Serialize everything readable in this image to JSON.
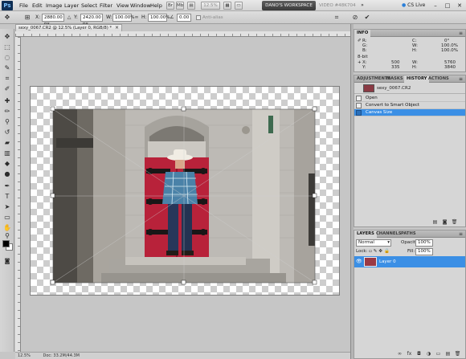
{
  "app": {
    "logo": "Ps"
  },
  "menubar": {
    "items": [
      "File",
      "Edit",
      "Image",
      "Layer",
      "Select",
      "Filter",
      "View",
      "Window",
      "Help"
    ],
    "zoom": "12.5%",
    "workspace": "DANO'S WORKSPACE",
    "video_tab": "VIDEO #48K704",
    "cs_live": "CS Live",
    "controls": [
      "–",
      "□",
      "✕"
    ]
  },
  "options": {
    "x_label": "X:",
    "x_value": "2880.00 px",
    "y_label": "Y:",
    "y_value": "2420.00 px",
    "w_label": "W:",
    "w_value": "100.00%",
    "h_label": "H:",
    "h_value": "100.00%",
    "angle_value": "0.00",
    "antialias": "Anti-alias",
    "cancel_icon": "cancel-transform-icon",
    "commit_icon": "commit-transform-icon"
  },
  "document": {
    "tab_title": "sexy_0067.CR2 @ 12.5% (Layer 0, RGB/8) *",
    "status_zoom": "12.5%",
    "status_info": "Doc: 33.2M/44.3M"
  },
  "info_panel": {
    "title": "INFO",
    "rows": [
      {
        "label": "R:",
        "value": ""
      },
      {
        "label": "C:",
        "value": "0°"
      },
      {
        "label": "G:",
        "value": ""
      },
      {
        "label": "W:",
        "value": "100.0%"
      },
      {
        "label": "B:",
        "value": ""
      },
      {
        "label": "H:",
        "value": "100.0%"
      },
      {
        "label": "8-bit",
        "value": ""
      },
      {
        "label": "",
        "value": ""
      },
      {
        "label": "X:",
        "value": "500"
      },
      {
        "label": "W:",
        "value": "5760"
      },
      {
        "label": "Y:",
        "value": "335"
      },
      {
        "label": "H:",
        "value": "3840"
      }
    ]
  },
  "history_panel": {
    "tabs": [
      "ADJUSTMENTS",
      "MASKS",
      "HISTORY",
      "ACTIONS"
    ],
    "active_tab": "HISTORY",
    "snapshot": "sexy_0067.CR2",
    "items": [
      {
        "label": "Open",
        "selected": false
      },
      {
        "label": "Convert to Smart Object",
        "selected": false
      },
      {
        "label": "Canvas Size",
        "selected": true
      }
    ]
  },
  "layers_panel": {
    "tabs": [
      "LAYERS",
      "CHANNELS",
      "PATHS"
    ],
    "active_tab": "LAYERS",
    "blend_mode": "Normal",
    "opacity_label": "Opacity:",
    "opacity_value": "100%",
    "lock_label": "Lock:",
    "fill_label": "Fill:",
    "fill_value": "100%",
    "layers": [
      {
        "name": "Layer 0",
        "selected": true
      }
    ]
  },
  "colors": {
    "selection": "#3b8fe5",
    "foreground": "#000000",
    "background": "#ffffff",
    "door": "#b8223a"
  }
}
